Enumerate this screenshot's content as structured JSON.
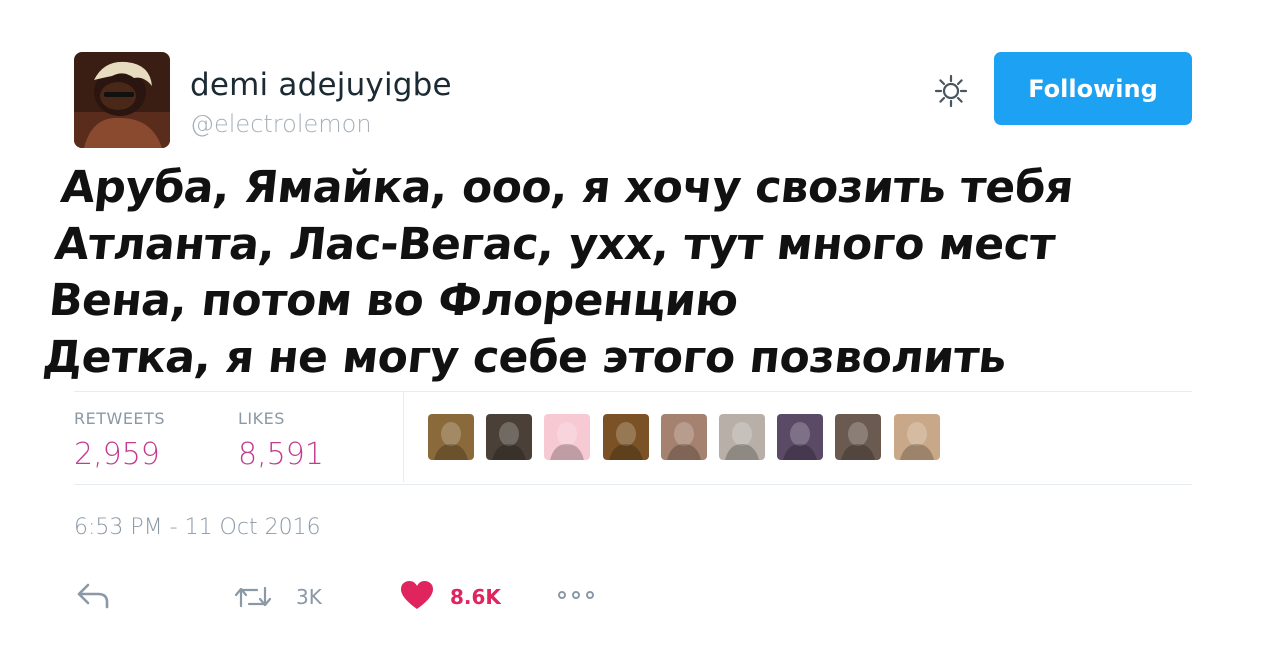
{
  "user": {
    "display_name": "demi adejuyigbe",
    "handle": "@electrolemon"
  },
  "follow_button": {
    "label": "Following",
    "color": "#1da1f2"
  },
  "tweet": {
    "lines": [
      "Аруба, Ямайка, ооо, я хочу свозить тебя",
      "Атланта, Лас-Вегас, ухх, тут много мест",
      "Вена, потом во Флоренцию",
      "Детка, я не могу себе этого позволить"
    ]
  },
  "stats": {
    "retweets_label": "RETWEETS",
    "retweets_value": "2,959",
    "likes_label": "LIKES",
    "likes_value": "8,591",
    "value_color": "#c23b8f"
  },
  "likers": [
    {
      "name": "liker-avatar-1",
      "color": "#8a6a3a"
    },
    {
      "name": "liker-avatar-2",
      "color": "#4a4038"
    },
    {
      "name": "liker-avatar-3",
      "color": "#f7c9d3"
    },
    {
      "name": "liker-avatar-4",
      "color": "#7a5226"
    },
    {
      "name": "liker-avatar-5",
      "color": "#a58270"
    },
    {
      "name": "liker-avatar-6",
      "color": "#b8b0a8"
    },
    {
      "name": "liker-avatar-7",
      "color": "#5a4a66"
    },
    {
      "name": "liker-avatar-8",
      "color": "#6a5a50"
    },
    {
      "name": "liker-avatar-9",
      "color": "#c8a888"
    }
  ],
  "timestamp": "6:53 PM - 11 Oct 2016",
  "actions": {
    "reply_icon": "reply-icon",
    "retweet_icon": "retweet-icon",
    "retweet_count": "3K",
    "like_icon": "heart-icon",
    "like_count": "8.6K",
    "like_color": "#e0245e",
    "more_icon": "more-icon"
  }
}
